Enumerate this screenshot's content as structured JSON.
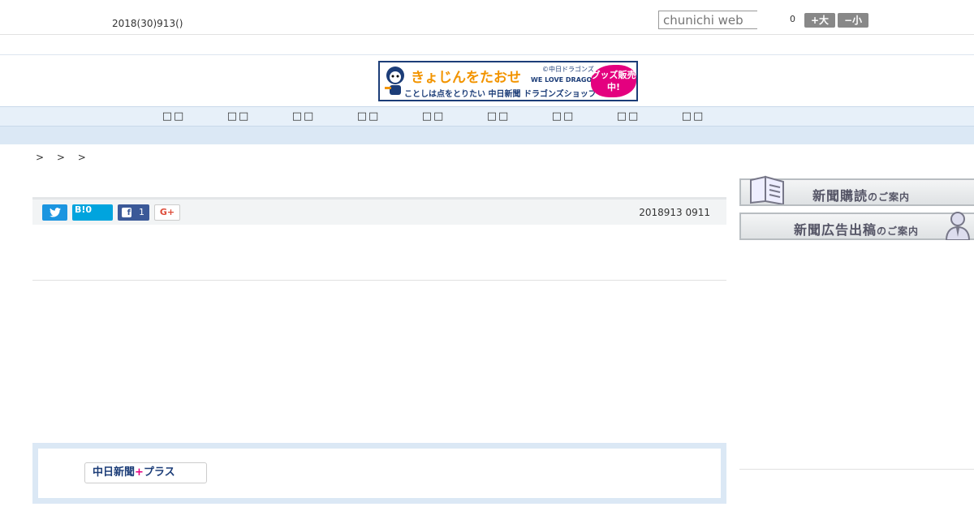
{
  "header": {
    "date_text": "2018(30)913()",
    "search_placeholder": "chunichi web",
    "count": "0",
    "font_large_label": "+大",
    "font_small_label": "−小"
  },
  "banner": {
    "main_text": "きょじんをたおせ",
    "sub_text": "ことしは点をとりたい 中日新聞 ドラゴンズショップ",
    "copyright_text": "©中日ドラゴンズ",
    "love_text": "WE LOVE DRAGONS",
    "badge_text": "グッズ販売中!"
  },
  "nav": {
    "items": [
      {
        "label": "□□"
      },
      {
        "label": "□□"
      },
      {
        "label": "□□"
      },
      {
        "label": "□□"
      },
      {
        "label": "□□"
      },
      {
        "label": "□□"
      },
      {
        "label": "□□"
      },
      {
        "label": "□□"
      },
      {
        "label": "□□"
      }
    ]
  },
  "breadcrumb": {
    "text": "> > >"
  },
  "share": {
    "hatena_label": "B!0",
    "facebook_count": "1",
    "gplus_label": "G+",
    "timestamp": "2018913 0911"
  },
  "plus": {
    "logo_main": "中日新聞",
    "logo_plus": "+",
    "logo_suffix": "プラス"
  },
  "sidebar": {
    "subscribe_main": "新聞購読",
    "subscribe_small": "のご案内",
    "ad_main": "新聞広告出稿",
    "ad_small": "のご案内"
  },
  "icons": {
    "twitter": "twitter-icon",
    "facebook": "facebook-icon",
    "newspaper": "newspaper-icon",
    "person": "person-icon"
  },
  "colors": {
    "nav_bg": "#e7f0f9",
    "twitter": "#1b95e0",
    "hatena": "#00a4de",
    "facebook": "#3b5998",
    "brand_navy": "#1c3d78",
    "accent_pink": "#e4007f"
  }
}
